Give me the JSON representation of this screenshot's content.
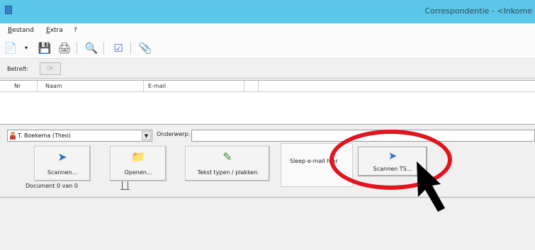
{
  "window": {
    "title": "Correspondentie - <Inkome",
    "icon": "app-icon"
  },
  "menu": {
    "items": [
      "Bestand",
      "Extra",
      "?"
    ]
  },
  "toolbar": {
    "icons": [
      "new-document-icon",
      "dropdown-icon",
      "save-icon",
      "print-icon",
      "print-preview-icon",
      "checklist-icon",
      "attachment-icon"
    ]
  },
  "betreft": {
    "label": "Betreft:",
    "button_icon": "handshake-icon"
  },
  "recipients": {
    "columns": [
      "Nr",
      "Naam",
      "E-mail"
    ],
    "rows": []
  },
  "sender": {
    "value": "T. Boekema (Theo)",
    "icon": "person-icon"
  },
  "subject": {
    "label": "Onderwerp:",
    "value": ""
  },
  "actions": {
    "scan_label": "Scannen...",
    "open_label": "Openen...",
    "type_paste_label": "Tekst typen / plakken",
    "drop_zone_label": "Sleep e-mail hier",
    "scan_ts_label": "Scannen TS..."
  },
  "document_counter": "Document 0 van 0",
  "colors": {
    "titlebar": "#5cc6e8",
    "highlight": "#e2141d",
    "arrow": "#000000"
  }
}
